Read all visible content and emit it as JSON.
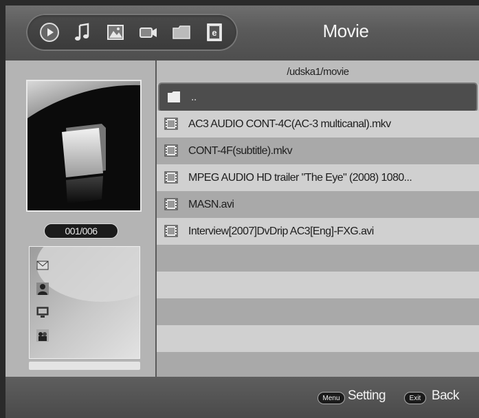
{
  "header": {
    "title": "Movie",
    "mode_icons": [
      "play-icon",
      "music-note-icon",
      "photo-icon",
      "video-camera-icon",
      "folder-icon",
      "ebook-icon"
    ]
  },
  "left_panel": {
    "counter": "001/006",
    "info_icons": [
      "mail-icon",
      "person-icon",
      "monitor-icon",
      "person-group-icon"
    ]
  },
  "file_browser": {
    "path": "/udska1/movie",
    "items": [
      {
        "label": "..",
        "icon": "folder-icon",
        "selected": true
      },
      {
        "label": "AC3  AUDIO CONT-4C(AC-3 multicanal).mkv",
        "icon": "film-icon"
      },
      {
        "label": "CONT-4F(subtitle).mkv",
        "icon": "film-icon"
      },
      {
        "label": "MPEG AUDIO HD trailer \"The Eye\" (2008) 1080...",
        "icon": "film-icon"
      },
      {
        "label": "MASN.avi",
        "icon": "film-icon"
      },
      {
        "label": "Interview[2007]DvDrip AC3[Eng]-FXG.avi",
        "icon": "film-icon"
      }
    ]
  },
  "footer": {
    "menu_key": "Menu",
    "menu_label": "Setting",
    "exit_key": "Exit",
    "exit_label": "Back"
  },
  "colors": {
    "header_bg": "#5a5a5a",
    "left_panel_bg": "#b4b4b4",
    "row_dark": "#a9a9a9",
    "row_light": "#d0d0d0",
    "selected_row": "#4d4d4d"
  }
}
